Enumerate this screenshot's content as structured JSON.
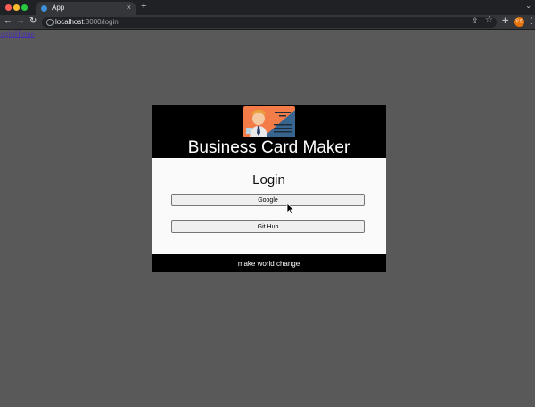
{
  "browser": {
    "tab_title": "App",
    "tab_close_glyph": "×",
    "new_tab_glyph": "+",
    "url_host": "localhost",
    "url_path": ":3000/login",
    "profile_initials": "유진",
    "icons": [
      "back-arrow-icon",
      "forward-arrow-icon",
      "reload-icon",
      "info-icon",
      "share-icon",
      "star-icon",
      "extensions-icon",
      "profile-avatar",
      "kebab-menu-icon"
    ]
  },
  "page": {
    "link_login": "login",
    "link_home": "Home"
  },
  "app": {
    "title": "Business Card Maker",
    "login_title": "Login",
    "google_button": "Google",
    "github_button": "Git Hub",
    "footer": "make world change",
    "colors": {
      "header_bg": "#000000",
      "body_bg": "#fafafa",
      "page_bg": "#595959",
      "logo_orange": "#f47c48",
      "logo_blue": "#37658f"
    }
  }
}
